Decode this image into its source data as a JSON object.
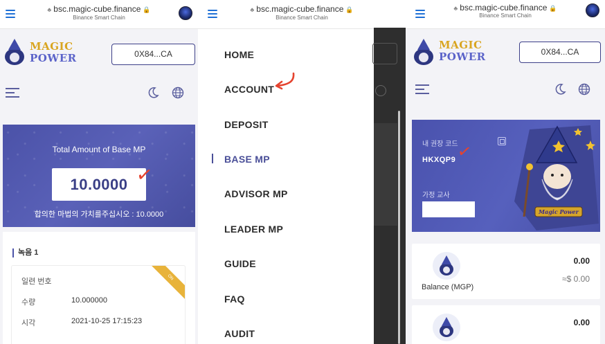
{
  "browser": {
    "url": "bsc.magic-cube.finance",
    "subtitle": "Binance Smart Chain"
  },
  "brand": {
    "line1": "MAGIC",
    "line2": "POWER"
  },
  "wallet": {
    "address": "0X84...CA"
  },
  "base_mp": {
    "title": "Total Amount of Base MP",
    "value": "10.0000",
    "footer": "합의한 마법의 가치를주십시오 : 10.0000"
  },
  "record": {
    "title": "녹음 1",
    "serial_label": "일련 번호",
    "quantity_label": "수량",
    "quantity_value": "10.000000",
    "time_label": "시각",
    "time_value": "2021-10-25 17:15:23"
  },
  "menu": {
    "items": [
      {
        "label": "HOME"
      },
      {
        "label": "ACCOUNT"
      },
      {
        "label": "DEPOSIT"
      },
      {
        "label": "BASE MP"
      },
      {
        "label": "ADVISOR MP"
      },
      {
        "label": "LEADER MP"
      },
      {
        "label": "GUIDE"
      },
      {
        "label": "FAQ"
      },
      {
        "label": "AUDIT"
      }
    ],
    "active": "BASE MP"
  },
  "account": {
    "referral_label": "내 권장 코드",
    "referral_code": "HKXQP9",
    "tutor_label": "가정 교사",
    "art_caption": "Magic Power",
    "balance_label": "Balance (MGP)",
    "balance_value": "0.00",
    "balance_usd": "≈$ 0.00",
    "balance2_value": "0.00"
  },
  "colors": {
    "accent": "#4b52a8",
    "gold": "#d9a520",
    "annotation": "#e5432f",
    "link_blue": "#1d6fd6"
  }
}
